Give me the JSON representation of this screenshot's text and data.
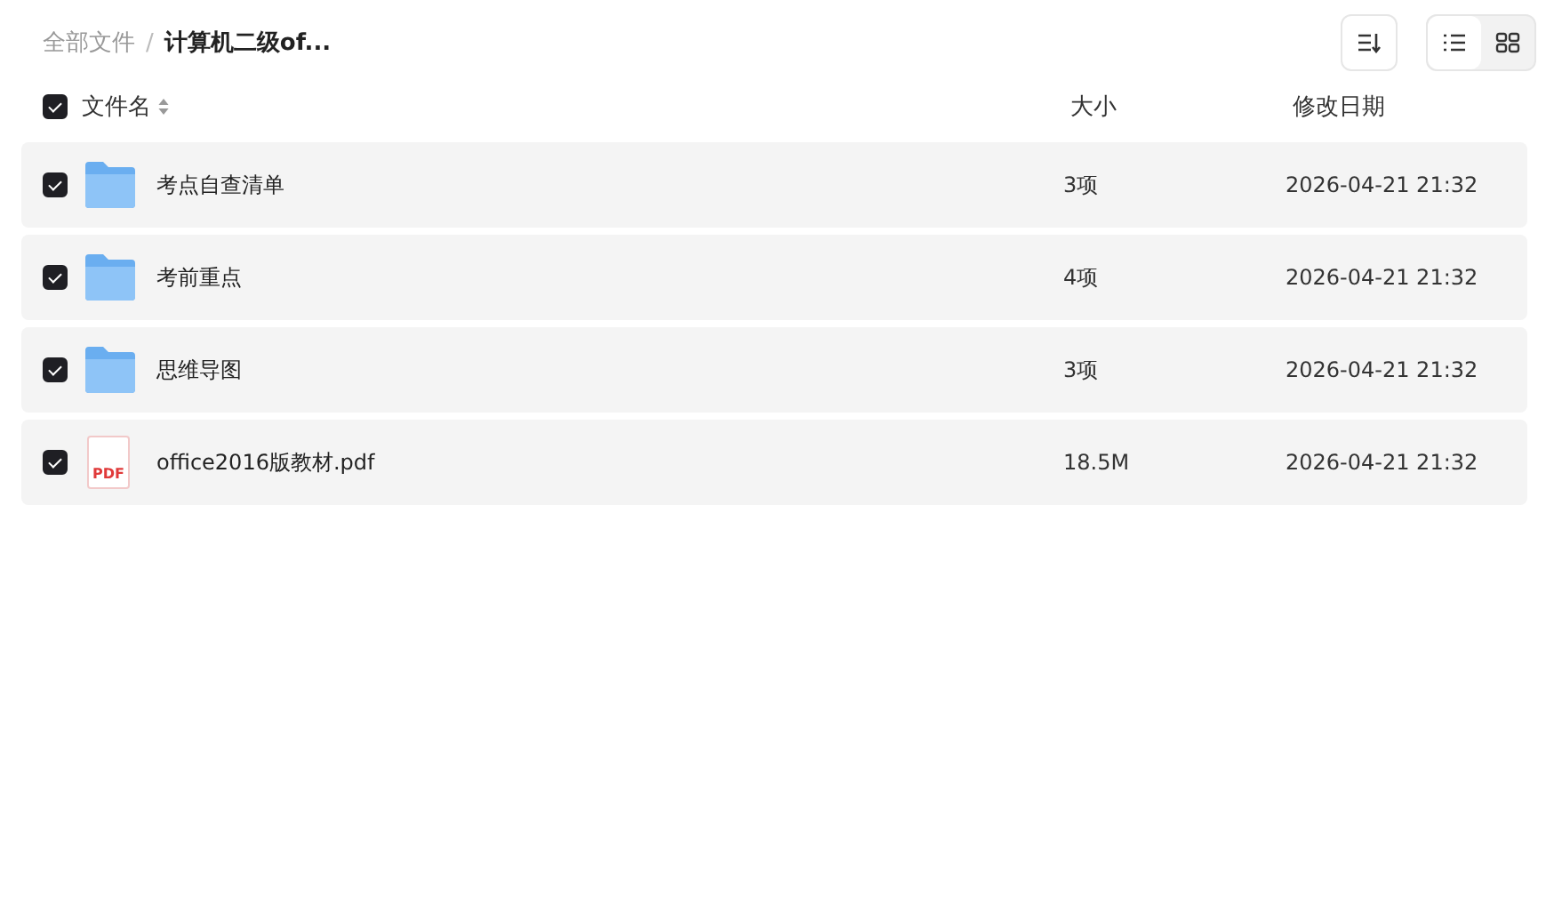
{
  "breadcrumb": [
    {
      "label": "全部文件",
      "current": false
    },
    {
      "label": "计算机二级of...",
      "current": true
    }
  ],
  "breadcrumb_separator": "/",
  "toolbar": {
    "views": [
      {
        "kind": "list",
        "selected": true
      },
      {
        "kind": "grid",
        "selected": false
      }
    ]
  },
  "header": {
    "checked": true,
    "columns": [
      "文件名",
      "大小",
      "修改日期"
    ]
  },
  "rows": [
    {
      "kind": "folder",
      "checked": true,
      "name": "考点自查清单",
      "size": "3项",
      "date": "2026-04-21 21:32"
    },
    {
      "kind": "folder",
      "checked": true,
      "name": "考前重点",
      "size": "4项",
      "date": "2026-04-21 21:32"
    },
    {
      "kind": "folder",
      "checked": true,
      "name": "思维导图",
      "size": "3项",
      "date": "2026-04-21 21:32"
    },
    {
      "kind": "pdf",
      "icon_text": "PDF",
      "checked": true,
      "name": "office2016版教材.pdf",
      "size": "18.5M",
      "date": "2026-04-21 21:32"
    }
  ]
}
